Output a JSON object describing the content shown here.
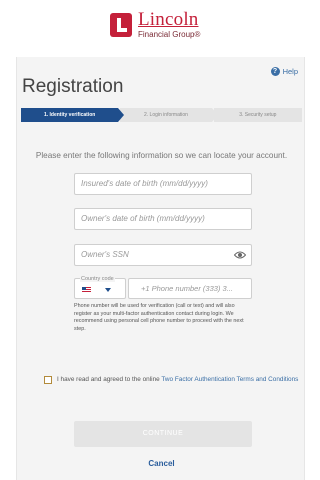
{
  "brand": {
    "name": "Lincoln",
    "sub": "Financial Group",
    "sub_mark": "®",
    "color": "#c4203a"
  },
  "help": {
    "label": "Help",
    "icon": "help-circle-icon"
  },
  "title": "Registration",
  "steps": [
    {
      "label": "1. Identity verification",
      "active": true
    },
    {
      "label": "2. Login information",
      "active": false
    },
    {
      "label": "3. Security setup",
      "active": false
    }
  ],
  "instructions": "Please enter the following information so we can locate your account.",
  "fields": {
    "insured_dob": {
      "placeholder": "Insured's date of birth (mm/dd/yyyy)"
    },
    "owner_dob": {
      "placeholder": "Owner's date of birth (mm/dd/yyyy)"
    },
    "owner_ssn": {
      "placeholder": "Owner's SSN"
    },
    "country_code": {
      "label": "Country code",
      "flag": "us-flag-icon"
    },
    "phone": {
      "placeholder": "+1 Phone number (333) 3..."
    }
  },
  "phone_note": "Phone number will be used for verification (call or text) and will also register as your multi-factor authentication contact during login. We recommend using personal cell phone number to proceed with the next step.",
  "agree": {
    "text": "I have read and agreed to the online ",
    "link": "Two Factor Authentication Terms and Conditions"
  },
  "continue_label": "CONTINUE",
  "cancel_label": "Cancel",
  "colors": {
    "primary": "#1f4e8c",
    "link": "#3a6ea5",
    "panel_bg": "#f4f4f4"
  }
}
